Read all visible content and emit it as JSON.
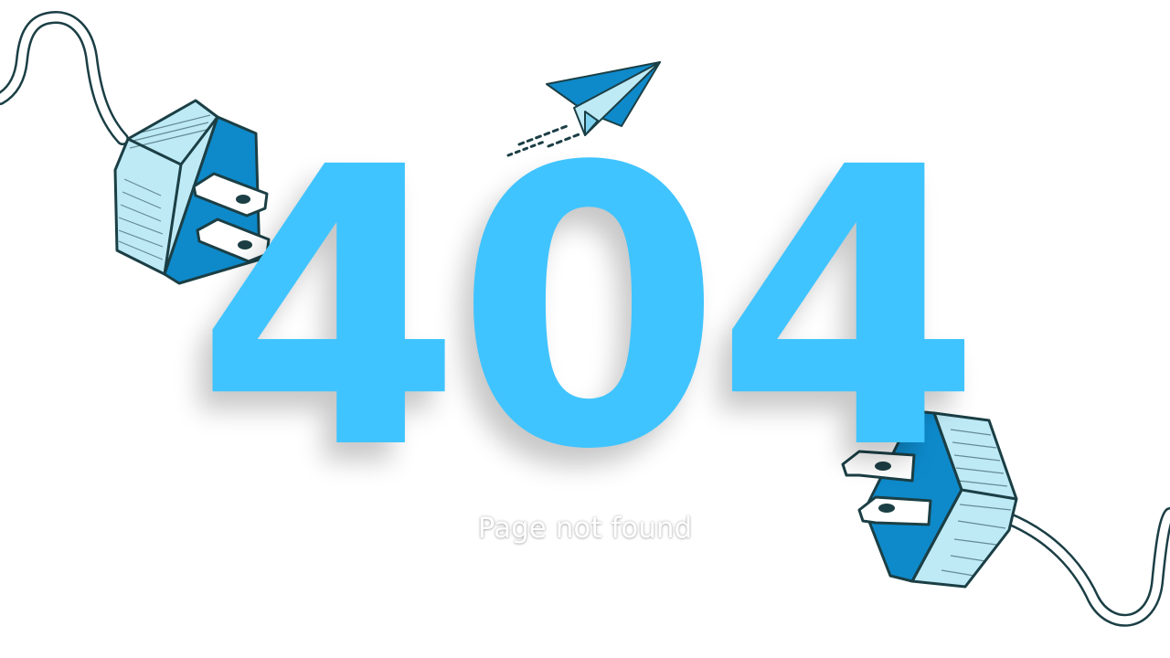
{
  "error_page": {
    "code": "404",
    "message": "Page not found"
  },
  "colors": {
    "accent": "#40C4FF",
    "plug_body": "#0E8ACB",
    "plug_face": "#BEEAF6",
    "outline": "#1B3F45"
  },
  "icons": [
    "paper-plane-icon",
    "plug-icon"
  ]
}
